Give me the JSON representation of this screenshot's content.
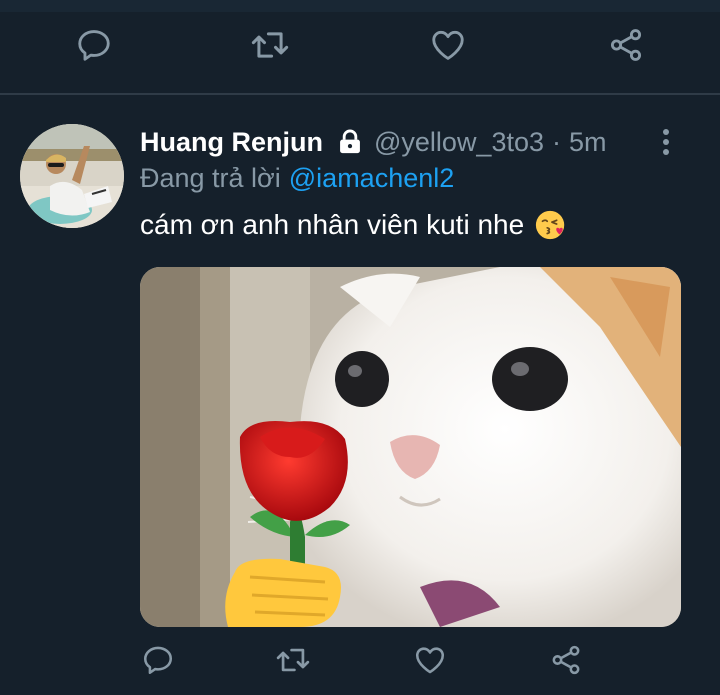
{
  "top_actions": {
    "items": [
      {
        "icon": "reply-icon"
      },
      {
        "icon": "retweet-icon"
      },
      {
        "icon": "like-icon"
      },
      {
        "icon": "share-icon"
      }
    ]
  },
  "tweet": {
    "display_name": "Huang Renjun",
    "protected_icon": "lock-icon",
    "handle": "@yellow_3to3",
    "separator": "·",
    "time": "5m",
    "reply_prefix": "Đang trả lời",
    "reply_to": "@iamachenl2",
    "text": "cám ơn anh nhân viên kuti nhe",
    "text_emoji": "face-blowing-a-kiss",
    "media_description_icon": "cat-holding-rose-image"
  },
  "bottom_actions": {
    "items": [
      {
        "icon": "reply-icon"
      },
      {
        "icon": "retweet-icon"
      },
      {
        "icon": "like-icon"
      },
      {
        "icon": "share-icon"
      }
    ]
  },
  "colors": {
    "background": "#15202b",
    "icon": "#8899a6",
    "link": "#1da1f2",
    "text": "#ffffff"
  }
}
